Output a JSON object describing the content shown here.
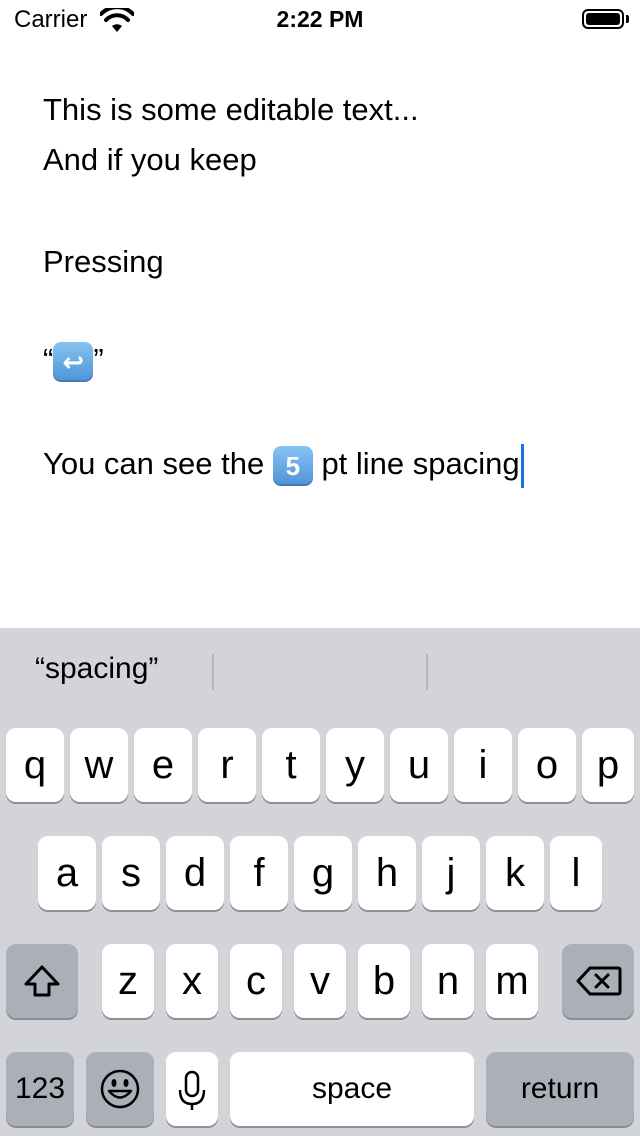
{
  "status_bar": {
    "carrier": "Carrier",
    "time": "2:22 PM"
  },
  "editor": {
    "lines": [
      "This is some editable text...",
      "And if you keep",
      "Pressing",
      "“",
      "”",
      "You can see the ",
      " pt line spacing"
    ],
    "return_emoji_symbol": "↩",
    "number_emoji": "5",
    "caret_color": "#1f6fe5"
  },
  "keyboard": {
    "suggestion": "“spacing”",
    "row1": [
      "q",
      "w",
      "e",
      "r",
      "t",
      "y",
      "u",
      "i",
      "o",
      "p"
    ],
    "row2": [
      "a",
      "s",
      "d",
      "f",
      "g",
      "h",
      "j",
      "k",
      "l"
    ],
    "row3": [
      "z",
      "x",
      "c",
      "v",
      "b",
      "n",
      "m"
    ],
    "numbers_label": "123",
    "space_label": "space",
    "return_label": "return"
  }
}
